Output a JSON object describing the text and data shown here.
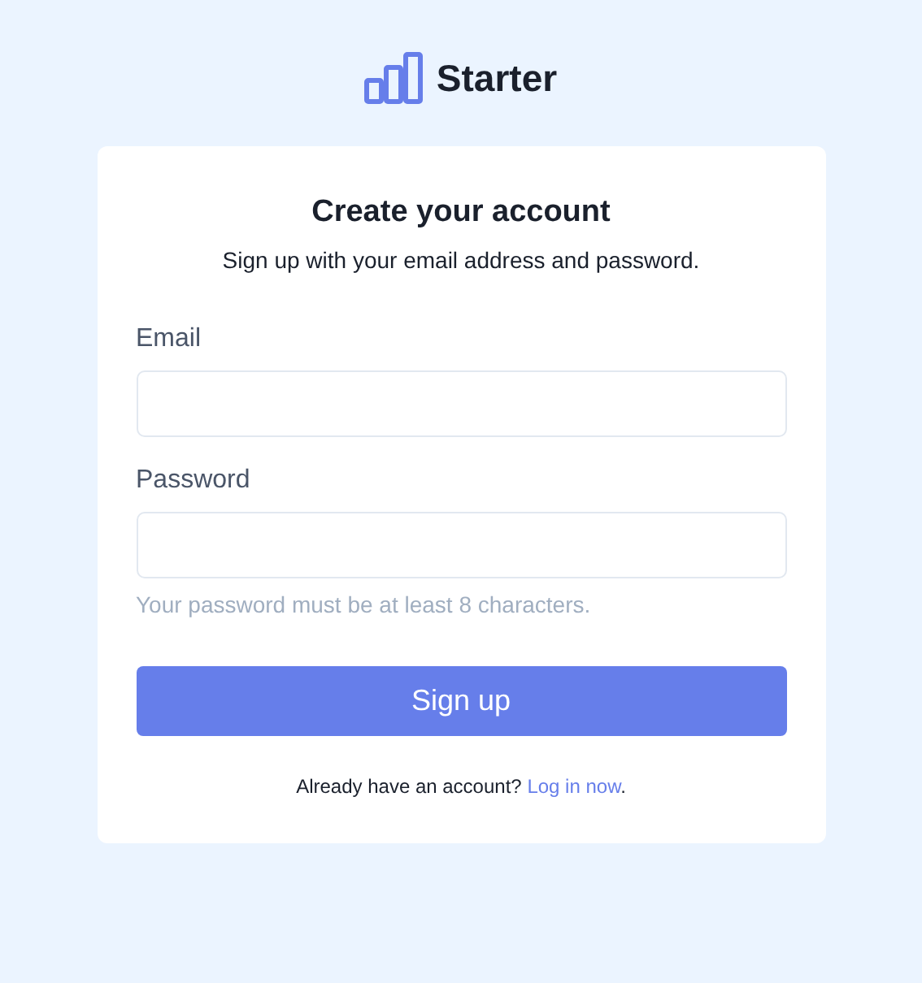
{
  "brand": {
    "name": "Starter"
  },
  "card": {
    "title": "Create your account",
    "subtitle": "Sign up with your email address and password.",
    "fields": [
      {
        "label": "Email"
      },
      {
        "label": "Password",
        "hint": "Your password must be at least 8 characters."
      }
    ],
    "submit": "Sign up",
    "footer": {
      "text": "Already have an account?",
      "link": "Log in now",
      "after": "."
    }
  }
}
